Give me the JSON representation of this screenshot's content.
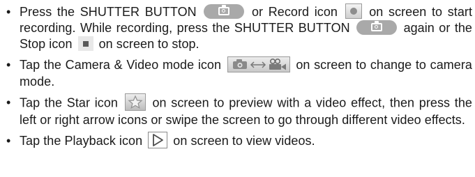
{
  "bullet_symbol": "•",
  "items": [
    {
      "t1": "Press the SHUTTER BUTTON",
      "t2": "or Record icon",
      "t3": "on screen to start recording. While recording, press the SHUTTER BUTTON",
      "t4": "again or the Stop icon",
      "t5": "on screen to stop."
    },
    {
      "t1": "Tap the Camera & Video mode icon",
      "t2": "on screen to change to camera mode."
    },
    {
      "t1": "Tap the Star icon",
      "t2": "on screen to preview with a video effect, then press the left or right arrow icons or swipe the screen to go through different video effects."
    },
    {
      "t1": "Tap the Playback icon",
      "t2": "on screen to view videos."
    }
  ],
  "icons": {
    "shutter": "camera-icon",
    "record": "record-dot-icon",
    "stop": "stop-square-icon",
    "mode": "camera-video-switch-icon",
    "star": "star-icon",
    "playback": "play-triangle-icon"
  }
}
